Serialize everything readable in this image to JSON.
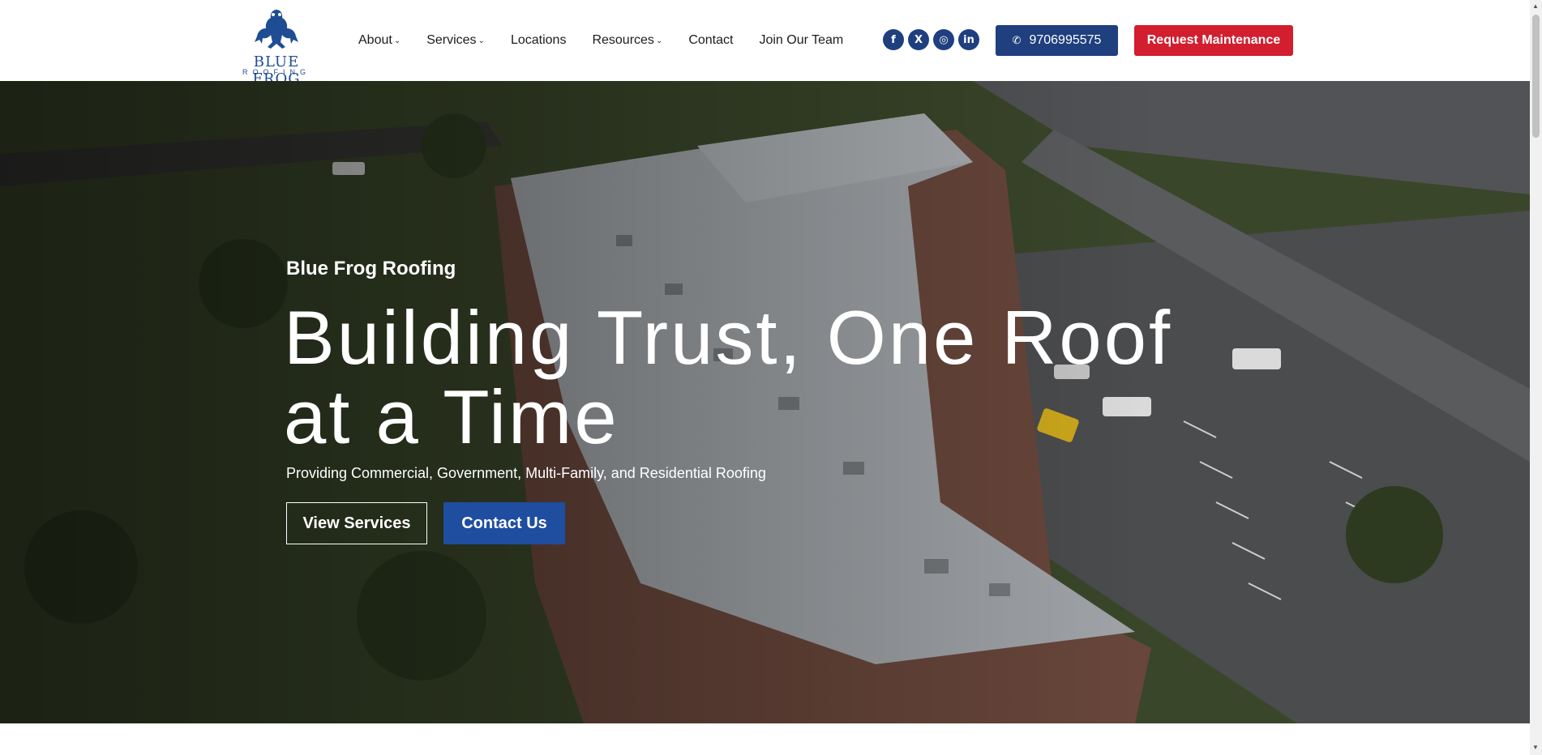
{
  "brand": {
    "logo_main": "BLUE FROG",
    "logo_sub": "ROOFING"
  },
  "nav": {
    "items": [
      {
        "label": "About",
        "dropdown": true
      },
      {
        "label": "Services",
        "dropdown": true
      },
      {
        "label": "Locations",
        "dropdown": false
      },
      {
        "label": "Resources",
        "dropdown": true
      },
      {
        "label": "Contact",
        "dropdown": false
      },
      {
        "label": "Join Our Team",
        "dropdown": false
      }
    ]
  },
  "socials": [
    {
      "icon": "facebook-icon",
      "glyph": "f"
    },
    {
      "icon": "x-icon",
      "glyph": "X"
    },
    {
      "icon": "instagram-icon",
      "glyph": "◎"
    },
    {
      "icon": "linkedin-icon",
      "glyph": "in"
    }
  ],
  "header_actions": {
    "phone_label": "9706995575",
    "phone_icon": "phone-icon",
    "request_label": "Request Maintenance"
  },
  "hero": {
    "eyebrow": "Blue Frog Roofing",
    "headline": "Building Trust, One Roof at a Time",
    "subline": "Providing Commercial, Government, Multi-Family, and Residential Roofing",
    "cta_primary": "View Services",
    "cta_secondary": "Contact Us"
  },
  "colors": {
    "brand_blue": "#1f3f7e",
    "cta_blue": "#1f4da0",
    "request_red": "#d21e2f"
  }
}
